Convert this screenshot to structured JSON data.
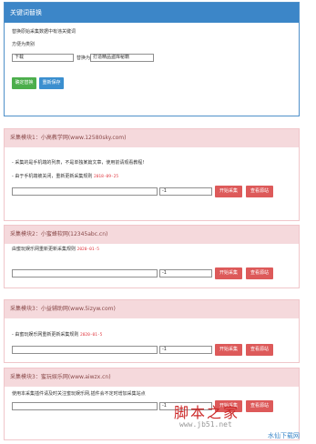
{
  "top": {
    "title": "关键词替换",
    "desc": "替换原始采集数据中有违关键词",
    "method_label": "方便为类别",
    "from_value": "下载",
    "replace_with_label": "替换为",
    "to_value": "打造精品盗库秘籍",
    "confirm_btn": "确定替换",
    "save_btn": "重新保存"
  },
  "sections": [
    {
      "title": "采集模块1：小高教学网(www.12580sky.com)",
      "lines": [
        {
          "text": "- 采集的是手机端的列表，不是单独某篇文章，使用前请观看教程!",
          "date": ""
        },
        {
          "text": "- 由于手机端被关闭，重新更新采集规则",
          "date": "2018-09-25"
        }
      ],
      "num_value": "-1",
      "start_btn": "开始采集",
      "view_btn": "查看源站"
    },
    {
      "title": "采集模块2：小蜜蜂软网(12345abc.cn)",
      "lines": [
        {
          "text": "由蜜玩娱乐网重新更新采集规则",
          "date": "2020-01-5"
        }
      ],
      "num_value": "-1",
      "start_btn": "开始采集",
      "view_btn": "查看源站"
    },
    {
      "title": "采集模块3：小益辅助网(www.5izyw.com)",
      "lines": [
        {
          "text": "- 由蜜玩娱乐网重新更新采集规则",
          "date": "2020-01-5"
        }
      ],
      "num_value": "-1",
      "start_btn": "开始采集",
      "view_btn": "查看源站"
    },
    {
      "title": "采集模块3：蜜玩娱乐网(www.aiwzx.cn)",
      "lines": [
        {
          "text": "使用本采集插件请及时关注蜜玩娱乐网,插件会不定时增加采集站点",
          "date": ""
        }
      ],
      "num_value": "-1",
      "start_btn": "开始采集",
      "view_btn": "查看源站"
    }
  ],
  "watermark": {
    "big": "脚本之家",
    "url": "www.jb51.net",
    "corner": "水仙下载网"
  }
}
